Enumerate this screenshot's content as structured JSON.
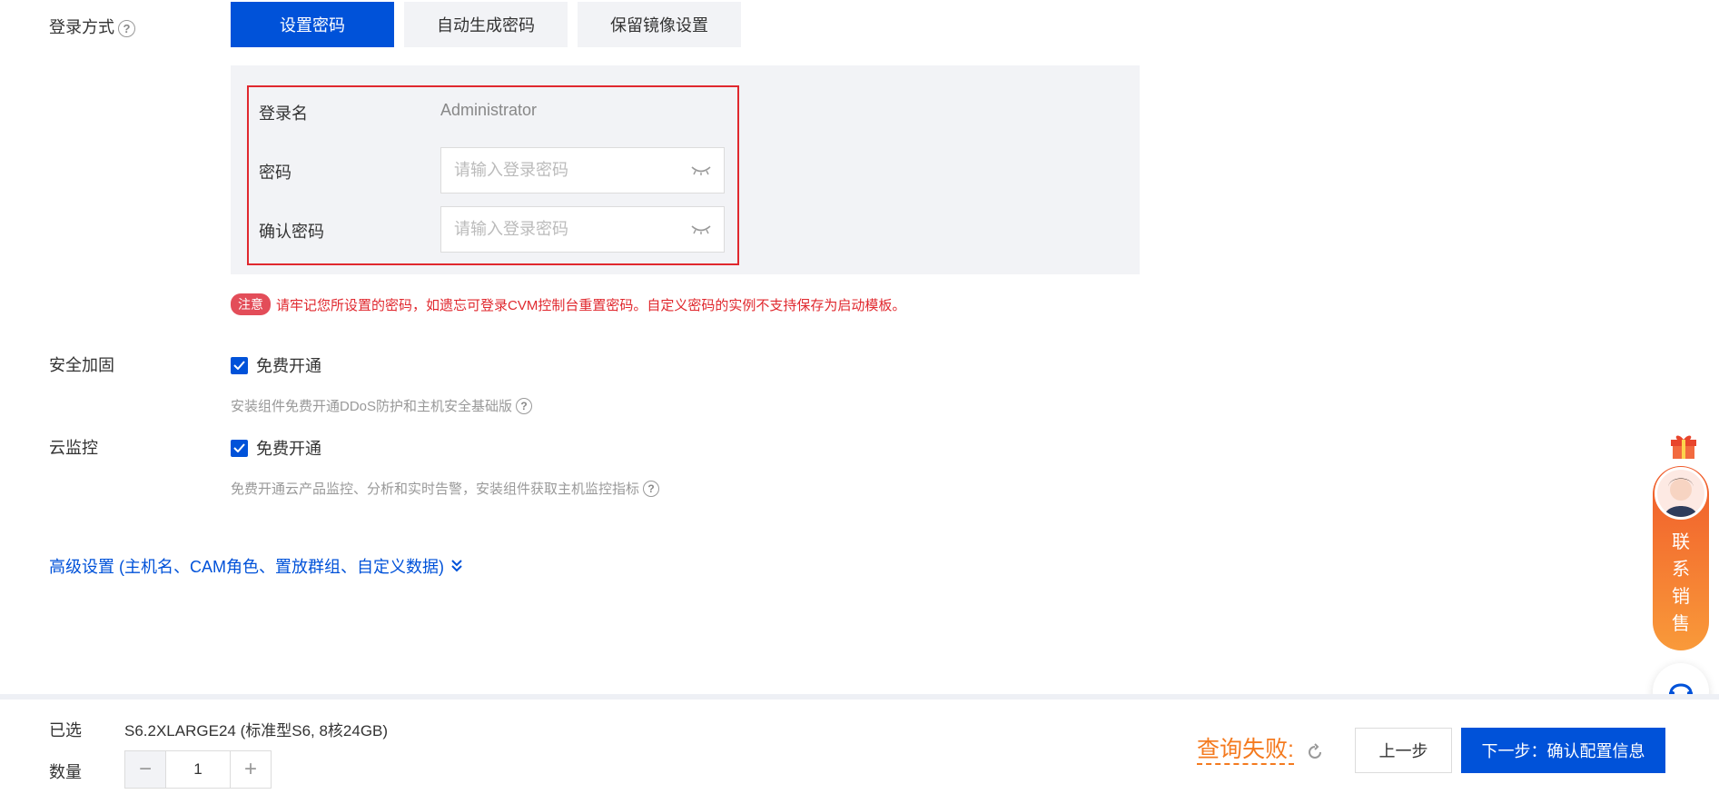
{
  "login": {
    "label": "登录方式",
    "tabs": [
      {
        "label": "设置密码",
        "active": true
      },
      {
        "label": "自动生成密码",
        "active": false
      },
      {
        "label": "保留镜像设置",
        "active": false
      }
    ],
    "username_label": "登录名",
    "username_value": "Administrator",
    "password_label": "密码",
    "password_placeholder": "请输入登录密码",
    "confirm_label": "确认密码",
    "confirm_placeholder": "请输入登录密码",
    "notice_badge": "注意",
    "notice_text": "请牢记您所设置的密码，如遗忘可登录CVM控制台重置密码。自定义密码的实例不支持保存为启动模板。"
  },
  "security": {
    "label": "安全加固",
    "checkbox_label": "免费开通",
    "checked": true,
    "hint": "安装组件免费开通DDoS防护和主机安全基础版"
  },
  "monitor": {
    "label": "云监控",
    "checkbox_label": "免费开通",
    "checked": true,
    "hint": "免费开通云产品监控、分析和实时告警，安装组件获取主机监控指标"
  },
  "advanced": {
    "label": "高级设置 (主机名、CAM角色、置放群组、自定义数据)"
  },
  "floating": {
    "sales_text": [
      "联",
      "系",
      "销",
      "售"
    ]
  },
  "bottom": {
    "selected_label": "已选",
    "selected_value": "S6.2XLARGE24 (标准型S6, 8核24GB)",
    "quantity_label": "数量",
    "quantity_value": "1",
    "minus": "−",
    "plus": "+",
    "query_fail": "查询失败:",
    "prev_label": "上一步",
    "next_label": "下一步：确认配置信息"
  },
  "colors": {
    "primary": "#0052d9",
    "danger": "#e0282e",
    "warning": "#f47a1f",
    "panel_bg": "#f2f3f6"
  }
}
